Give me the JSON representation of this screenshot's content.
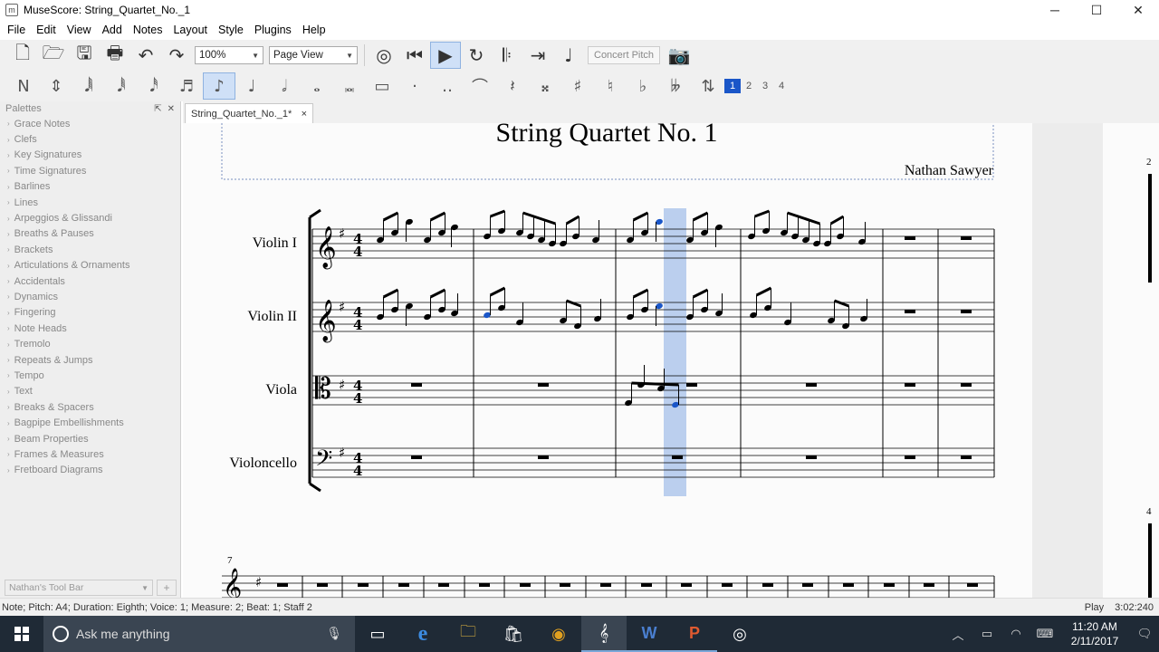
{
  "window": {
    "title": "MuseScore: String_Quartet_No._1",
    "minimize": "─",
    "maximize": "☐",
    "close": "✕"
  },
  "menu": [
    "File",
    "Edit",
    "View",
    "Add",
    "Notes",
    "Layout",
    "Style",
    "Plugins",
    "Help"
  ],
  "toolbar": {
    "zoom": "100%",
    "view_mode": "Page View",
    "concert_pitch": "Concert Pitch",
    "voices": [
      "1",
      "2",
      "3",
      "4"
    ]
  },
  "palettes": {
    "title": "Palettes",
    "items": [
      "Grace Notes",
      "Clefs",
      "Key Signatures",
      "Time Signatures",
      "Barlines",
      "Lines",
      "Arpeggios & Glissandi",
      "Breaths & Pauses",
      "Brackets",
      "Articulations & Ornaments",
      "Accidentals",
      "Dynamics",
      "Fingering",
      "Note Heads",
      "Tremolo",
      "Repeats & Jumps",
      "Tempo",
      "Text",
      "Breaks & Spacers",
      "Bagpipe Embellishments",
      "Beam Properties",
      "Frames & Measures",
      "Fretboard Diagrams"
    ],
    "workspace": "Nathan's Tool Bar",
    "add": "+"
  },
  "tab": {
    "label": "String_Quartet_No._1*",
    "close": "×"
  },
  "score": {
    "title": "String Quartet No. 1",
    "composer": "Nathan Sawyer",
    "instruments": [
      "Violin I",
      "Violin II",
      "Viola",
      "Violoncello"
    ],
    "time_sig_num": "4",
    "time_sig_den": "4",
    "measure_number": "7",
    "right_page_number_1": "2",
    "right_page_number_2": "4"
  },
  "status": {
    "left": "Note; Pitch: A4; Duration: Eighth; Voice: 1;  Measure: 2; Beat: 1; Staff 2",
    "mode": "Play",
    "time": "3:02:240"
  },
  "taskbar": {
    "search_placeholder": "Ask me anything",
    "time": "11:20 AM",
    "date": "2/11/2017"
  },
  "colors": {
    "selection": "#1a56c8",
    "playhead": "#9fbce8",
    "taskbar": "#1f2a36"
  }
}
